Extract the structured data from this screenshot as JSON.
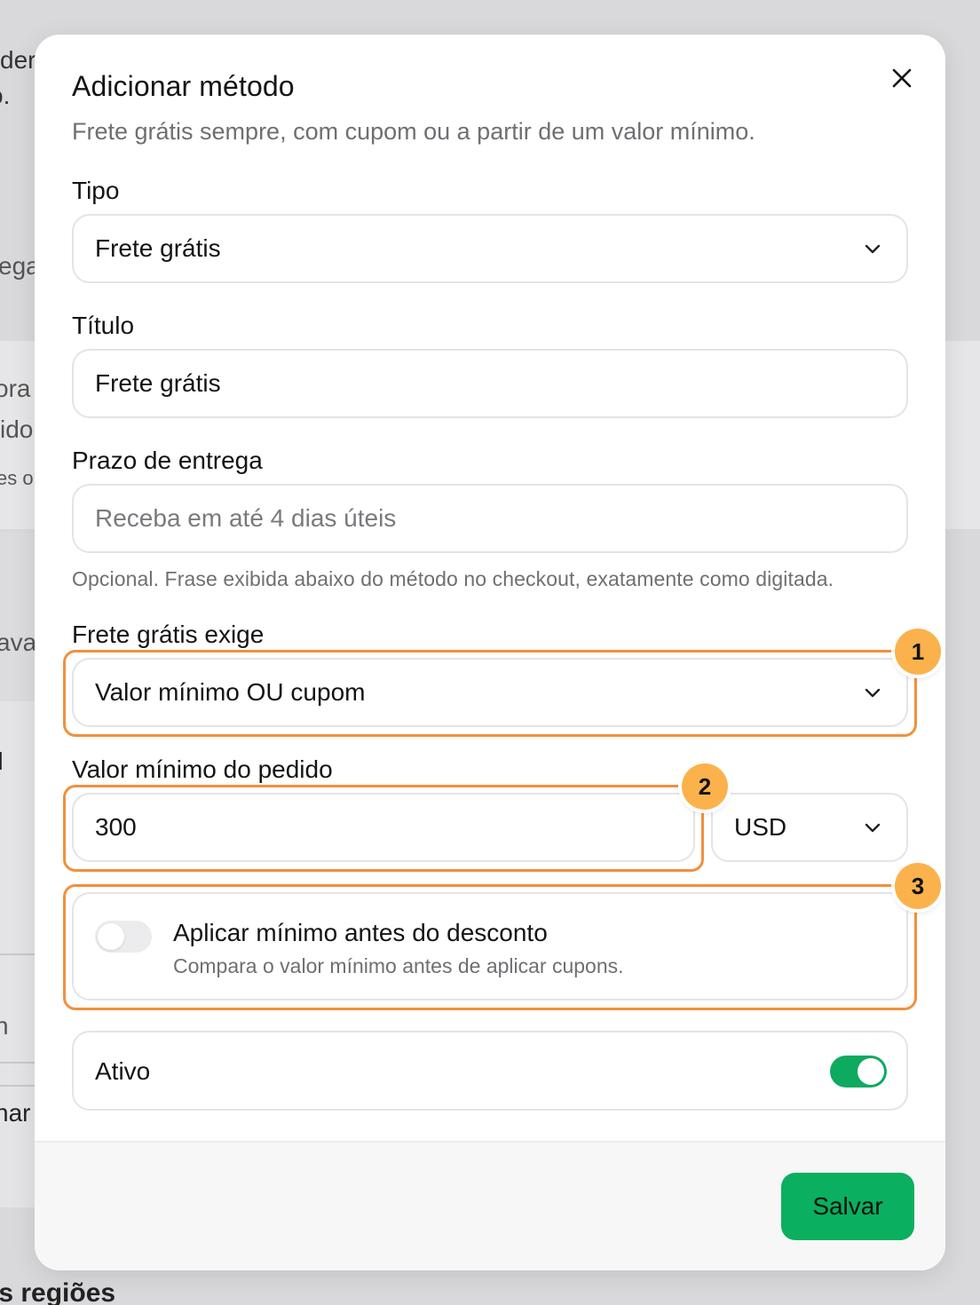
{
  "background": {
    "fragments": [
      "der",
      "o.",
      "ega",
      "ora",
      "ido",
      "es o",
      "aval",
      "l",
      "n",
      "nar",
      "is regiões"
    ]
  },
  "modal": {
    "title": "Adicionar método",
    "subtitle": "Frete grátis sempre, com cupom ou a partir de um valor mínimo.",
    "close_icon": "close-icon"
  },
  "form": {
    "tipo": {
      "label": "Tipo",
      "value": "Frete grátis"
    },
    "titulo": {
      "label": "Título",
      "value": "Frete grátis"
    },
    "prazo": {
      "label": "Prazo de entrega",
      "placeholder": "Receba em até 4 dias úteis",
      "hint": "Opcional. Frase exibida abaixo do método no checkout, exatamente como digitada."
    },
    "exige": {
      "label": "Frete grátis exige",
      "value": "Valor mínimo OU cupom"
    },
    "valor_minimo": {
      "label": "Valor mínimo do pedido",
      "value": "300",
      "currency": "USD"
    },
    "aplicar_minimo": {
      "title": "Aplicar mínimo antes do desconto",
      "description": "Compara o valor mínimo antes de aplicar cupons.",
      "enabled": false
    },
    "ativo": {
      "label": "Ativo",
      "enabled": true
    }
  },
  "footer": {
    "save_label": "Salvar"
  },
  "annotations": {
    "one": "1",
    "two": "2",
    "three": "3"
  },
  "colors": {
    "accent_green": "#0aaf5f",
    "highlight_orange": "#f2903d",
    "badge_orange": "#fbb24c"
  }
}
